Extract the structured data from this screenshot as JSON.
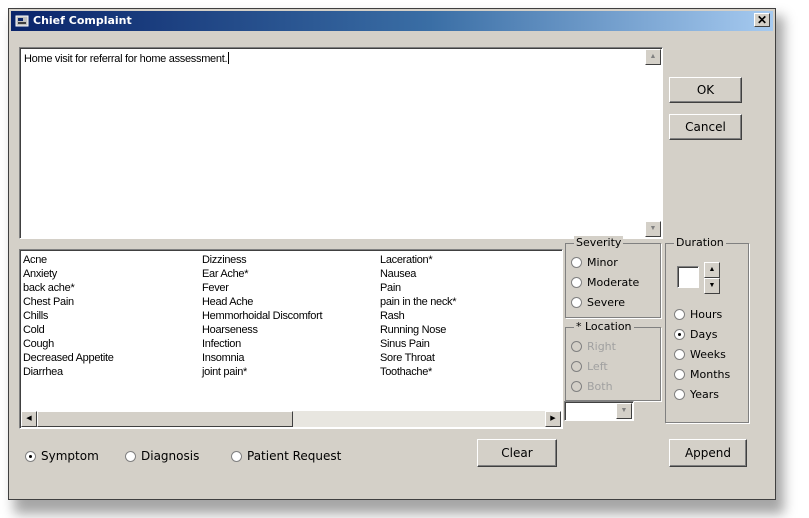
{
  "window": {
    "title": "Chief Complaint",
    "close_symbol": "✕"
  },
  "complaint": {
    "value": "Home visit for referral for home assessment."
  },
  "buttons": {
    "ok": "OK",
    "cancel": "Cancel",
    "clear": "Clear",
    "append": "Append"
  },
  "list": {
    "columns": [
      [
        "Acne",
        "Anxiety",
        "back ache*",
        "Chest Pain",
        "Chills",
        "Cold",
        "Cough",
        "Decreased Appetite",
        "Diarrhea"
      ],
      [
        "Dizziness",
        "Ear Ache*",
        "Fever",
        "Head Ache",
        "Hemmorhoidal Discomfort",
        "Hoarseness",
        "Infection",
        "Insomnia",
        "joint pain*"
      ],
      [
        "Laceration*",
        "Nausea",
        "Pain",
        "pain in the neck*",
        "Rash",
        "Running Nose",
        "Sinus Pain",
        "Sore Throat",
        "Toothache*"
      ]
    ]
  },
  "severity": {
    "label": "Severity",
    "options": [
      "Minor",
      "Moderate",
      "Severe"
    ]
  },
  "location": {
    "label": "* Location",
    "options": [
      "Right",
      "Left",
      "Both"
    ]
  },
  "duration": {
    "label": "Duration",
    "value": "",
    "options": [
      "Hours",
      "Days",
      "Weeks",
      "Months",
      "Years"
    ],
    "selected": "Days"
  },
  "type_options": {
    "options": [
      "Symptom",
      "Diagnosis",
      "Patient Request"
    ],
    "selected": "Symptom"
  },
  "icons": {
    "window": "app-icon",
    "up": "arrow-up-icon",
    "down": "arrow-down-icon",
    "left": "arrow-left-icon",
    "right": "arrow-right-icon"
  }
}
